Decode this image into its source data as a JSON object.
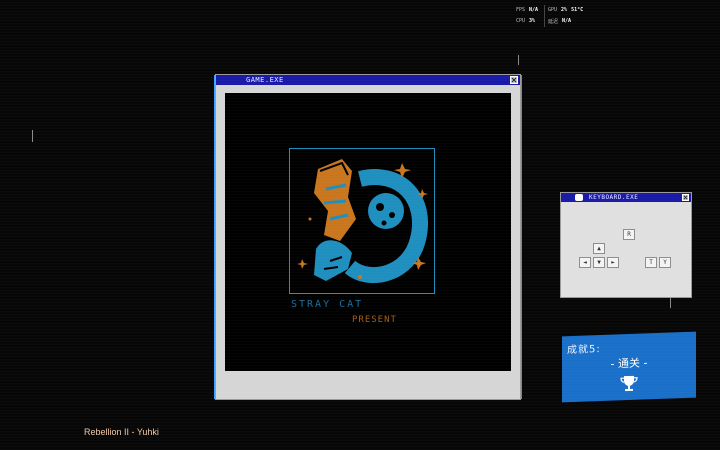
{
  "hud": {
    "fps_label": "FPS",
    "fps_value": "N/A",
    "gpu_label": "GPU",
    "gpu_value": "2%",
    "gpu_temp": "51°C",
    "cpu_label": "CPU",
    "cpu_value": "3%",
    "vram_label": "延迟",
    "vram_value": "N/A"
  },
  "game_window": {
    "title": "GAME.EXE",
    "studio_name": "STRAY CAT",
    "studio_sub": "PRESENT",
    "accent_blue": "#1f8fbf",
    "accent_orange": "#c9761f"
  },
  "keyboard_window": {
    "title": "KEYBOARD.EXE",
    "keys": {
      "r": "R",
      "up": "▲",
      "left": "◄",
      "down": "▼",
      "right": "►",
      "t": "T",
      "y": "Y"
    }
  },
  "achievement": {
    "title": "成就5:",
    "name": "- 通关 -",
    "icon": "trophy-icon",
    "color": "#1a6fc8"
  },
  "now_playing": {
    "text": "Rebellion II - Yuhki"
  }
}
